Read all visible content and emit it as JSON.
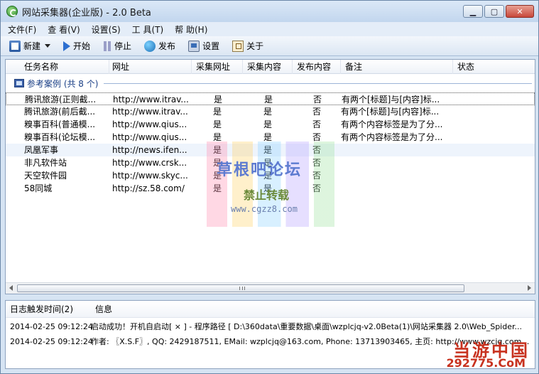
{
  "window": {
    "title": "网站采集器(企业版) - 2.0 Beta",
    "minimize": "▁",
    "maximize": "▢",
    "close": "✕"
  },
  "menu": [
    "文件(F)",
    "查 看(V)",
    "设置(S)",
    "工 具(T)",
    "帮 助(H)"
  ],
  "toolbar": {
    "new": "新建",
    "start": "开始",
    "stop": "停止",
    "publish": "发布",
    "settings": "设置",
    "about": "关于"
  },
  "grid": {
    "columns": [
      "任务名称",
      "网址",
      "采集网址",
      "采集内容",
      "发布内容",
      "备注",
      "状态"
    ],
    "group_label": "参考案例 (共 8 个)",
    "rows": [
      {
        "name": "腾讯旅游(正则截...",
        "url": "http://www.itrav...",
        "collect_url": "是",
        "collect_content": "是",
        "publish_content": "否",
        "note": "有两个[标题]与[内容]标..."
      },
      {
        "name": "腾讯旅游(前后截...",
        "url": "http://www.itrav...",
        "collect_url": "是",
        "collect_content": "是",
        "publish_content": "否",
        "note": "有两个[标题]与[内容]标..."
      },
      {
        "name": "糗事百科(普通模...",
        "url": "http://www.qius...",
        "collect_url": "是",
        "collect_content": "是",
        "publish_content": "否",
        "note": "有两个内容标签是为了分..."
      },
      {
        "name": "糗事百科(论坛模...",
        "url": "http://www.qius...",
        "collect_url": "是",
        "collect_content": "是",
        "publish_content": "否",
        "note": "有两个内容标签是为了分..."
      },
      {
        "name": "凤凰军事",
        "url": "http://news.ifen...",
        "collect_url": "是",
        "collect_content": "是",
        "publish_content": "否",
        "note": ""
      },
      {
        "name": "非凡软件站",
        "url": "http://www.crsk...",
        "collect_url": "是",
        "collect_content": "是",
        "publish_content": "否",
        "note": ""
      },
      {
        "name": "天空软件园",
        "url": "http://www.skyc...",
        "collect_url": "是",
        "collect_content": "是",
        "publish_content": "否",
        "note": ""
      },
      {
        "name": "58同城",
        "url": "http://sz.58.com/",
        "collect_url": "是",
        "collect_content": "是",
        "publish_content": "否",
        "note": ""
      }
    ]
  },
  "log": {
    "columns": [
      "日志触发时间(2)",
      "信息"
    ],
    "rows": [
      {
        "time": "2014-02-25 09:12:24",
        "message": "启动成功！开机自启动[ × ] - 程序路径 [ D:\\360data\\重要数据\\桌面\\wzplcjq-v2.0Beta(1)\\网站采集器 2.0\\Web_Spider..."
      },
      {
        "time": "2014-02-25 09:12:24",
        "message": "作者: 〖X.S.F〗, QQ: 2429187511, EMail: wzplcjq@163.com, Phone: 13713903465, 主页: http://www.wzcjq.com/ [..."
      }
    ]
  },
  "watermark": {
    "line1": "草根吧论坛",
    "line2": "禁止转载",
    "line3": "www.cgzz8.com"
  },
  "badge": {
    "logo": "当游中国",
    "url": "292775.CoM"
  }
}
